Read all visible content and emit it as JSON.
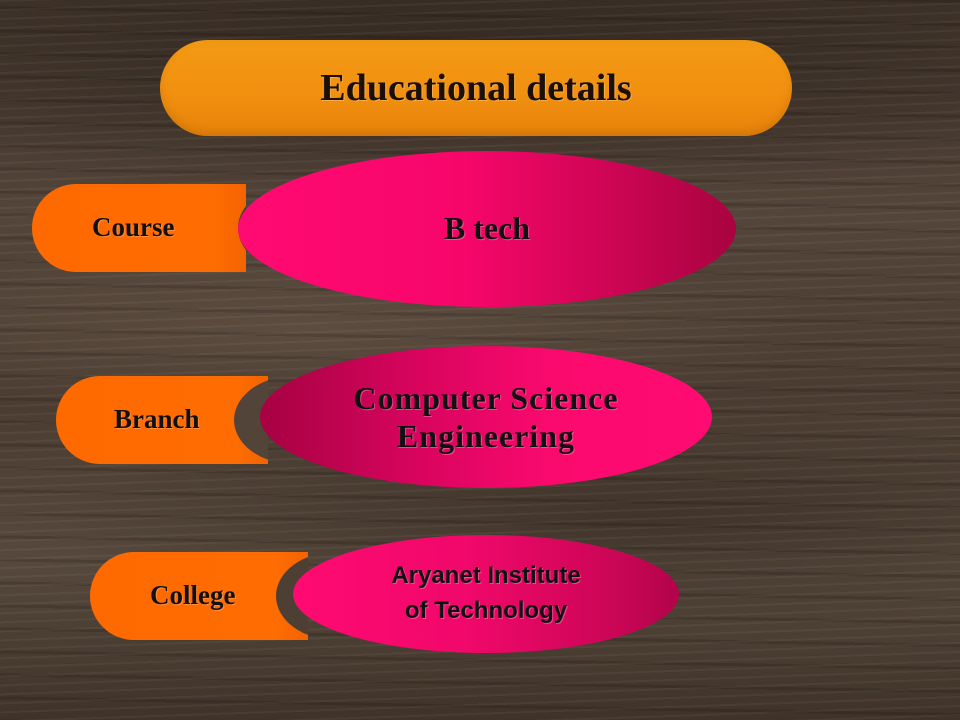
{
  "slide": {
    "title": "Educational details",
    "rows": [
      {
        "label": "Course",
        "value": "B tech"
      },
      {
        "label": "Branch",
        "value_line1": "Computer Science",
        "value_line2": "Engineering"
      },
      {
        "label": "College",
        "value_line1": "Aryanet Institute",
        "value_line2": "of Technology"
      }
    ]
  },
  "colors": {
    "title_fill": "#f29a14",
    "label_fill": "#ff6a00",
    "oval_fill": "#ff0a72",
    "background": "#4a3b30",
    "text": "#111111"
  }
}
